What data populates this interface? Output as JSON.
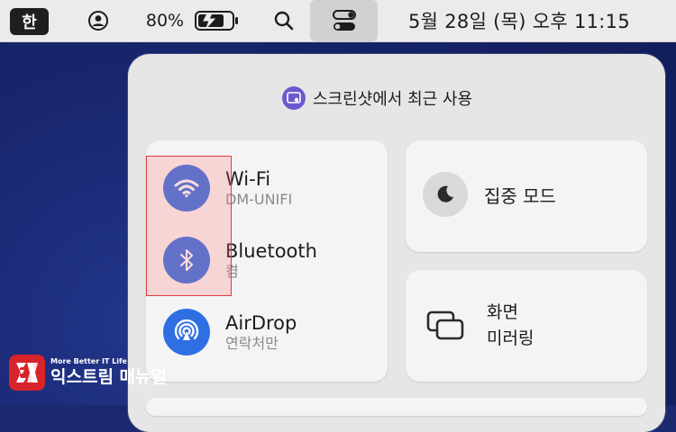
{
  "menubar": {
    "input_source": "한",
    "battery_percent": "80%",
    "clock": "5월 28일 (목) 오후 11:15",
    "icons": [
      "user-icon",
      "battery-charging-icon",
      "search-icon",
      "control-center-icon"
    ]
  },
  "control_center": {
    "recent_label": "스크린샷에서 최근 사용",
    "network": {
      "wifi": {
        "title": "Wi-Fi",
        "subtitle": "DM-UNIFI",
        "state": "on"
      },
      "bluetooth": {
        "title": "Bluetooth",
        "subtitle": "켬",
        "state": "on"
      },
      "airdrop": {
        "title": "AirDrop",
        "subtitle": "연락처만",
        "state": "on"
      }
    },
    "focus": {
      "label": "집중 모드",
      "icon": "moon-icon"
    },
    "mirroring": {
      "line1": "화면",
      "line2": "미러링",
      "icon": "screen-mirroring-icon"
    }
  },
  "watermark": {
    "tagline": "More Better IT Life",
    "name": "익스트림 매뉴얼"
  },
  "colors": {
    "accent": "#2f6fe4",
    "menubar": "#ebebeb",
    "panel": "#e6e6e6",
    "highlight_border": "#e03b3b",
    "desktop": "#1b2a6e"
  }
}
